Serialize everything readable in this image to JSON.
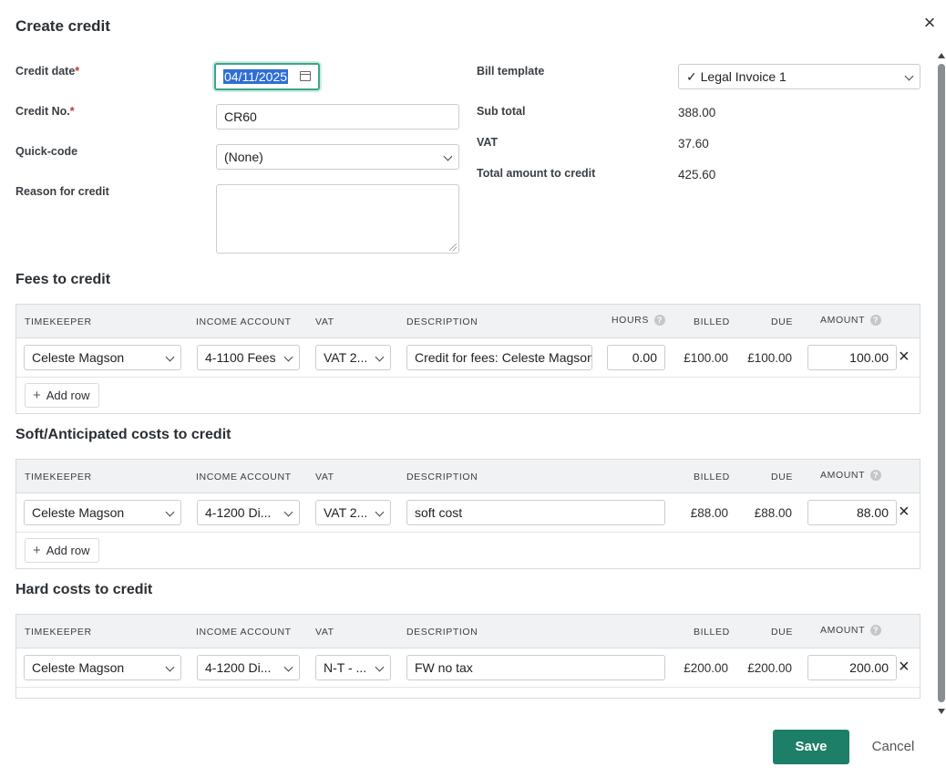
{
  "dialog": {
    "title": "Create credit",
    "close_glyph": "×"
  },
  "form": {
    "credit_date_label": "Credit date",
    "credit_date_value": "04/11/2025",
    "credit_no_label": "Credit No.",
    "credit_no_value": "CR60",
    "quick_code_label": "Quick-code",
    "quick_code_value": "(None)",
    "reason_label": "Reason for credit",
    "required_mark": "*",
    "bill_template_label": "Bill template",
    "bill_template_value": "✓ Legal Invoice 1",
    "sub_total_label": "Sub total",
    "sub_total_value": "388.00",
    "vat_label": "VAT",
    "vat_value": "37.60",
    "total_label": "Total amount to credit",
    "total_value": "425.60"
  },
  "columns": {
    "timekeeper": "TIMEKEEPER",
    "income_account": "INCOME ACCOUNT",
    "vat": "VAT",
    "description": "DESCRIPTION",
    "hours": "HOURS",
    "billed": "BILLED",
    "due": "DUE",
    "amount": "AMOUNT",
    "help_glyph": "?"
  },
  "fees": {
    "title": "Fees to credit",
    "row": {
      "timekeeper": "Celeste Magson",
      "income_account": "4-1100 Fees",
      "vat": "VAT 2...",
      "description": "Credit for fees:  Celeste Magson",
      "hours": "0.00",
      "billed": "£100.00",
      "due": "£100.00",
      "amount": "100.00"
    },
    "add_row_label": "Add row"
  },
  "soft_costs": {
    "title": "Soft/Anticipated costs to credit",
    "row": {
      "timekeeper": "Celeste Magson",
      "income_account": "4-1200 Di...",
      "vat": "VAT 2...",
      "description": "soft cost",
      "billed": "£88.00",
      "due": "£88.00",
      "amount": "88.00"
    },
    "add_row_label": "Add row"
  },
  "hard_costs": {
    "title": "Hard costs to credit",
    "row": {
      "timekeeper": "Celeste Magson",
      "income_account": "4-1200 Di...",
      "vat": "N-T - ...",
      "description": "FW no tax",
      "billed": "£200.00",
      "due": "£200.00",
      "amount": "200.00"
    }
  },
  "actions": {
    "save_label": "Save",
    "cancel_label": "Cancel"
  },
  "colors": {
    "primary": "#1e7f68",
    "focus_ring": "#3aa58a",
    "required": "#c0392b",
    "selection": "#2f6fd4"
  },
  "icons": [
    "close-icon",
    "calendar-icon",
    "chevron-down-icon",
    "help-icon",
    "plus-icon",
    "remove-row-icon",
    "scroll-up-icon",
    "scroll-down-icon"
  ]
}
